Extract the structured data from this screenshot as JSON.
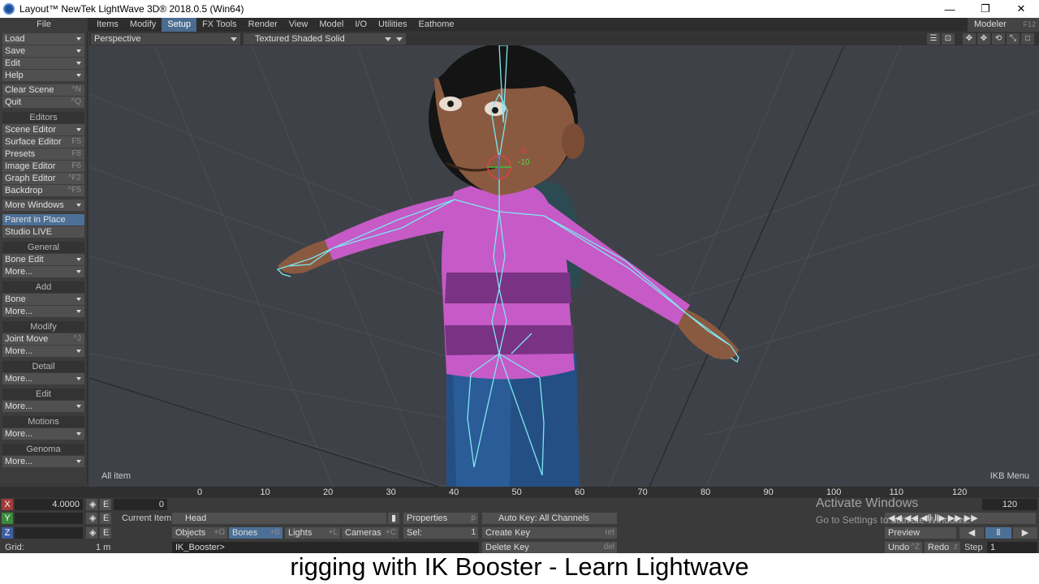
{
  "window": {
    "title": "Layout™ NewTek LightWave 3D® 2018.0.5 (Win64)",
    "minimize": "—",
    "restore": "❐",
    "close": "✕"
  },
  "menubar": {
    "file": "File",
    "tabs": [
      "Items",
      "Modify",
      "Setup",
      "FX Tools",
      "Render",
      "View",
      "Model",
      "I/O",
      "Utilities",
      "Eathome"
    ],
    "active_tab": "Setup",
    "modeler": "Modeler",
    "modeler_key": "F12"
  },
  "sidebar": {
    "file_items": [
      {
        "label": "Load"
      },
      {
        "label": "Save"
      },
      {
        "label": "Edit"
      },
      {
        "label": "Help"
      }
    ],
    "clear_scene": {
      "label": "Clear Scene",
      "key": "^N"
    },
    "quit": {
      "label": "Quit",
      "key": "^Q"
    },
    "editors_head": "Editors",
    "editors": [
      {
        "label": "Scene Editor",
        "key": ""
      },
      {
        "label": "Surface Editor",
        "key": "F5"
      },
      {
        "label": "Presets",
        "key": "F8"
      },
      {
        "label": "Image Editor",
        "key": "F6"
      },
      {
        "label": "Graph Editor",
        "key": "^F2"
      },
      {
        "label": "Backdrop",
        "key": "^F5"
      }
    ],
    "more_windows": "More Windows",
    "parent_in_place": "Parent in Place",
    "studio_live": "Studio LIVE",
    "general_head": "General",
    "bone_edit": "Bone Edit",
    "more": "More...",
    "add_head": "Add",
    "bone": "Bone",
    "modify_head": "Modify",
    "joint_move": "Joint Move",
    "joint_move_key": "^J",
    "detail_head": "Detail",
    "edit_head": "Edit",
    "motions_head": "Motions",
    "genoma_head": "Genoma"
  },
  "viewport": {
    "view_mode": "Perspective",
    "shading": "Textured Shaded Solid",
    "all_item": "All item",
    "ikb_menu": "IKB Menu",
    "handle_x": "0",
    "handle_y": "-10"
  },
  "timeline": {
    "ticks": [
      "0",
      "10",
      "20",
      "30",
      "40",
      "50",
      "60",
      "70",
      "80",
      "90",
      "100",
      "110",
      "120"
    ]
  },
  "bottom": {
    "x_label": "X",
    "y_label": "Y",
    "z_label": "Z",
    "x_value": "4.0000",
    "e_label": "E",
    "frame_start": "0",
    "frame_current": "0",
    "frame_end": "120",
    "current_item_label": "Current Item",
    "current_item": "Head",
    "properties": "Properties",
    "properties_key": "p",
    "auto_key": "Auto Key: All Channels",
    "objects": "Objects",
    "objects_key": "+O",
    "bones": "Bones",
    "bones_key": "+B",
    "lights": "Lights",
    "lights_key": "+L",
    "cameras": "Cameras",
    "cameras_key": "+C",
    "sel_label": "Sel:",
    "sel_value": "1",
    "create_key": "Create Key",
    "create_key_key": "ret",
    "delete_key": "Delete Key",
    "delete_key_key": "del",
    "grid_label": "Grid:",
    "grid_value": "1 m",
    "status": "IK_Booster>",
    "preview": "Preview",
    "undo": "Undo",
    "undo_key": "^Z",
    "redo": "Redo",
    "redo_key": "z",
    "step_label": "Step",
    "step_value": "1"
  },
  "watermark": {
    "line1": "Activate Windows",
    "line2": "Go to Settings to activate Windows."
  },
  "caption": "rigging with IK Booster - Learn Lightwave",
  "colors": {
    "accent": "#4c6f95",
    "bone": "#7fe6f0",
    "shirt": "#c65ac7"
  }
}
